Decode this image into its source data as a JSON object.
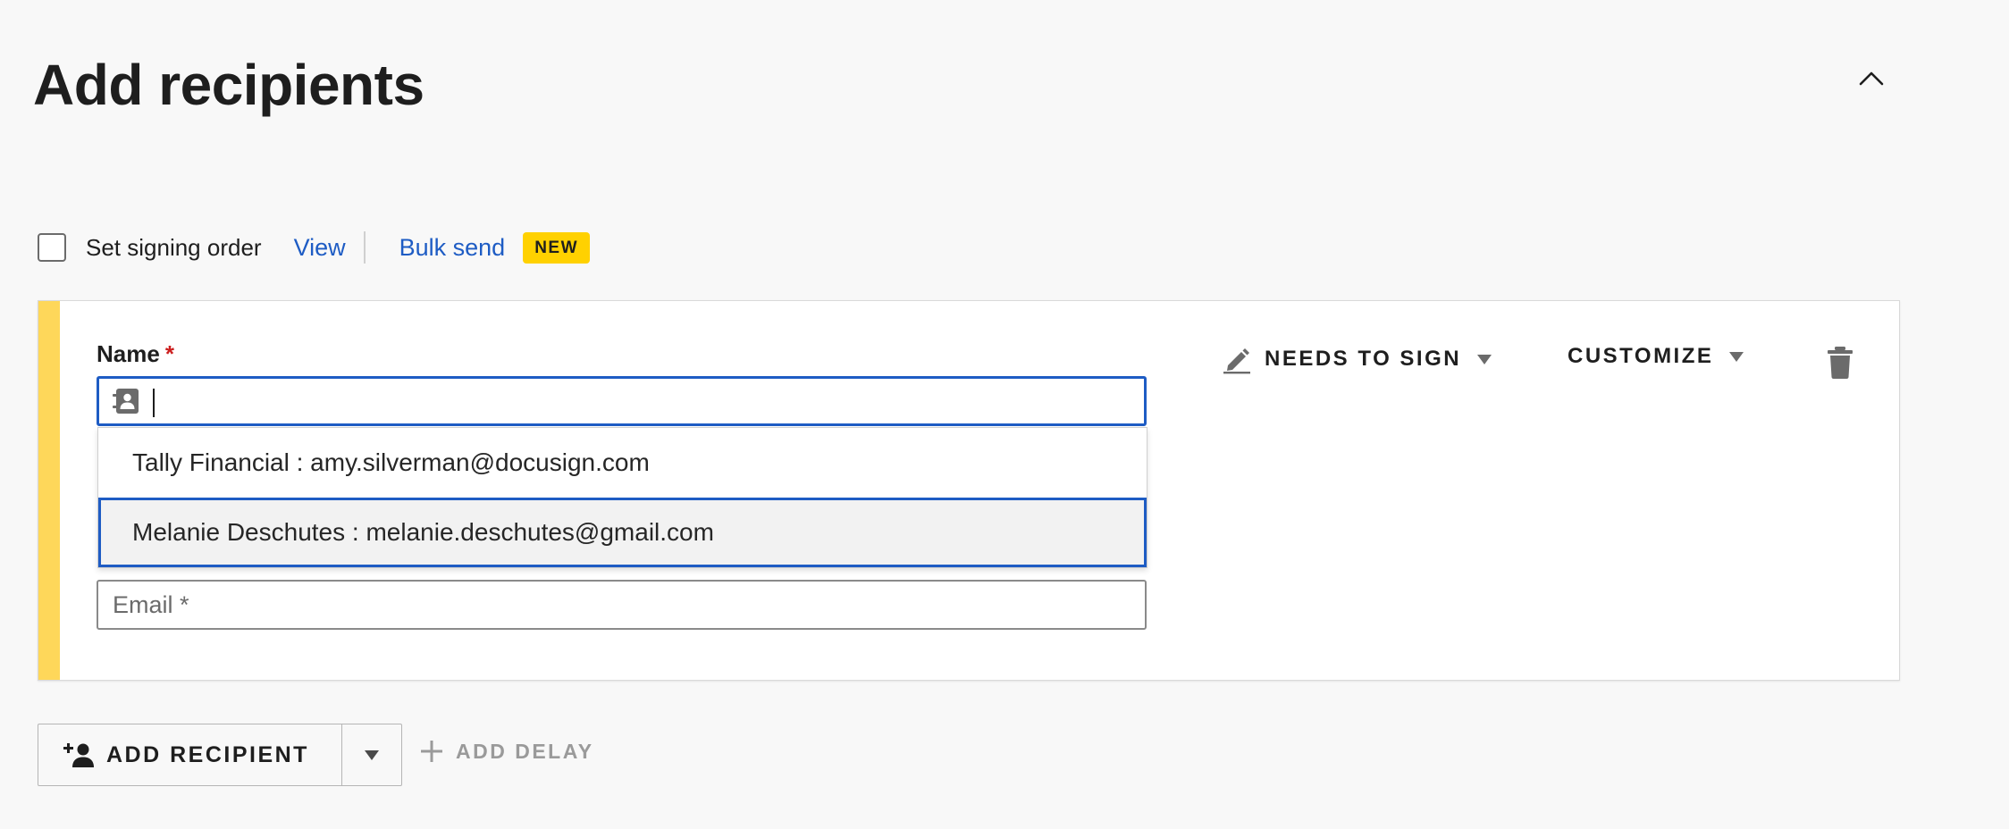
{
  "header": {
    "title": "Add recipients"
  },
  "options": {
    "signing_order_label": "Set signing order",
    "view_link": "View",
    "bulk_send_link": "Bulk send",
    "new_badge": "NEW"
  },
  "recipient": {
    "name_label": "Name",
    "required_mark": "*",
    "name_value": "",
    "email_placeholder": "Email *",
    "suggestions": [
      {
        "text": "Tally Financial : amy.silverman@docusign.com",
        "highlighted": false
      },
      {
        "text": "Melanie Deschutes : melanie.deschutes@gmail.com",
        "highlighted": true
      }
    ],
    "action_label": "NEEDS TO SIGN",
    "customize_label": "CUSTOMIZE"
  },
  "footer": {
    "add_recipient_label": "ADD RECIPIENT",
    "add_delay_label": "ADD DELAY"
  },
  "colors": {
    "accent_bar": "#fed75a",
    "link": "#1e5cc4",
    "badge": "#ffd100",
    "focus_border": "#1e5cc4"
  },
  "icons": {
    "collapse": "chevron-up-icon",
    "contact": "contact-card-icon",
    "pen": "pen-icon",
    "trash": "trash-icon",
    "add_user": "add-user-icon",
    "plus": "plus-icon"
  }
}
